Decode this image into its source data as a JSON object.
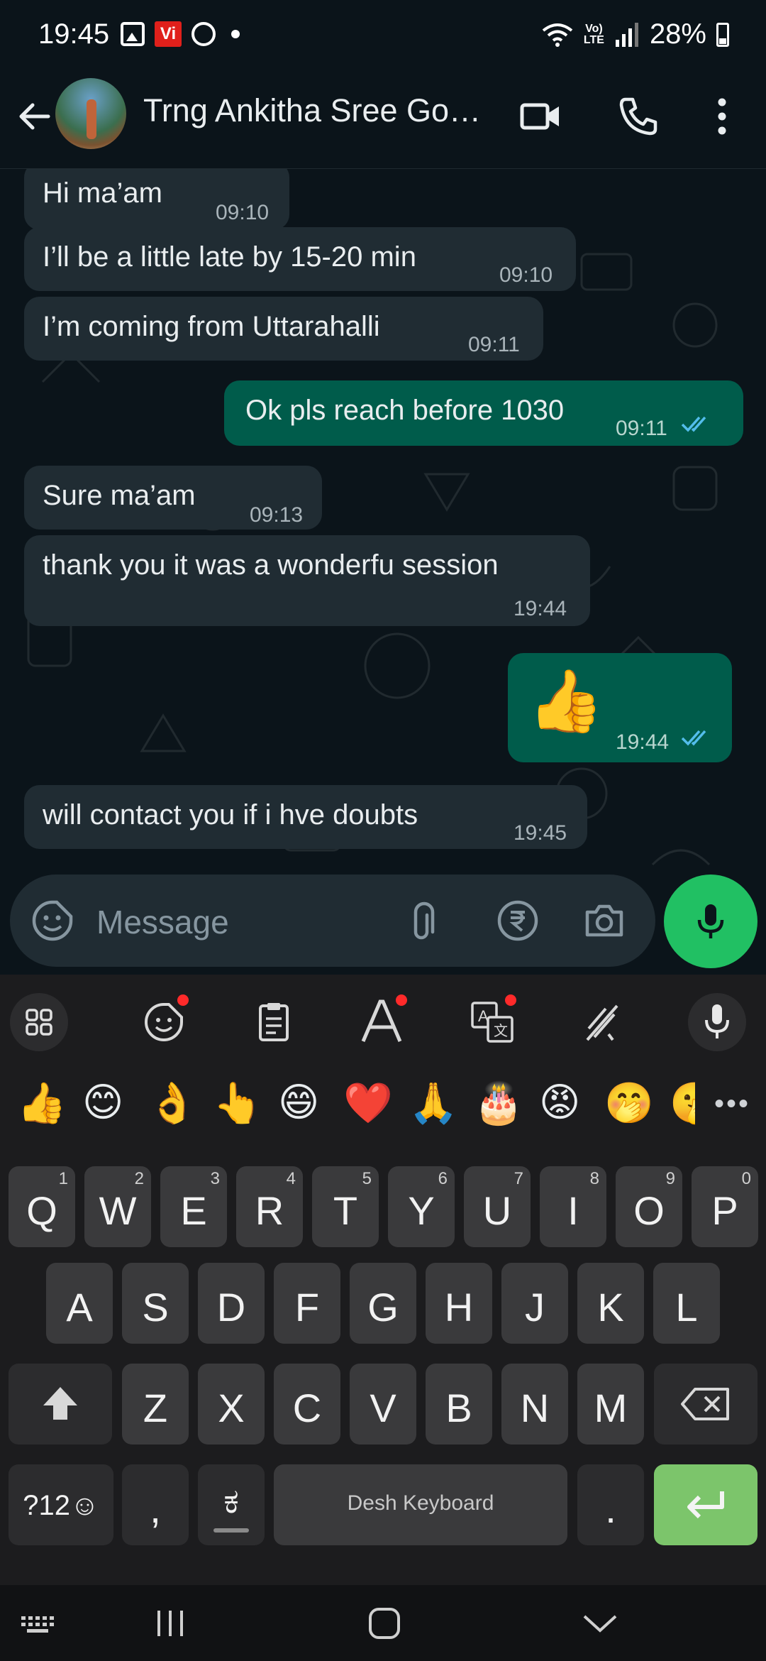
{
  "status_bar": {
    "time": "19:45",
    "volte": "Vo)\nLTE",
    "battery": "28%",
    "vi_label": "Vi"
  },
  "header": {
    "title": "Trng Ankitha Sree Go…",
    "icons": [
      "back-arrow-icon",
      "video-call-icon",
      "phone-icon",
      "more-vert-icon"
    ]
  },
  "messages": [
    {
      "dir": "in",
      "text": "Hi ma’am",
      "time": "09:10"
    },
    {
      "dir": "in",
      "text": "I’ll be a little late by 15-20 min",
      "time": "09:10"
    },
    {
      "dir": "in",
      "text": "I’m coming from Uttarahalli",
      "time": "09:11"
    },
    {
      "dir": "out",
      "text": "Ok pls reach before 1030",
      "time": "09:11",
      "status": "read"
    },
    {
      "dir": "in",
      "text": "Sure ma’am",
      "time": "09:13"
    },
    {
      "dir": "in",
      "text": "thank you it was a wonderfu session",
      "time": "19:44"
    },
    {
      "dir": "out",
      "text": "👍",
      "time": "19:44",
      "status": "read"
    },
    {
      "dir": "in",
      "text": "will contact you if i hve doubts",
      "time": "19:45"
    }
  ],
  "input": {
    "placeholder": "Message",
    "icons": [
      "sticker-icon",
      "attach-icon",
      "rupee-payment-icon",
      "camera-icon",
      "mic-icon"
    ]
  },
  "keyboard": {
    "toolbar_icons": [
      "apps-grid-icon",
      "sticker-emoji-icon",
      "clipboard-icon",
      "text-style-icon",
      "translate-icon",
      "handwriting-icon",
      "voice-input-icon"
    ],
    "emojis": [
      "👍",
      "😊",
      "👌",
      "👆",
      "😄",
      "❤️",
      "🙏",
      "🎂",
      "😡",
      "🤭",
      "🤫"
    ],
    "more": "•••",
    "row1": [
      "Q",
      "W",
      "E",
      "R",
      "T",
      "Y",
      "U",
      "I",
      "O",
      "P"
    ],
    "row1_numbers": [
      "1",
      "2",
      "3",
      "4",
      "5",
      "6",
      "7",
      "8",
      "9",
      "0"
    ],
    "row2": [
      "A",
      "S",
      "D",
      "F",
      "G",
      "H",
      "J",
      "K",
      "L"
    ],
    "row3": [
      "Z",
      "X",
      "C",
      "V",
      "B",
      "N",
      "M"
    ],
    "symbols_key": "?12☺",
    "comma_key": ",",
    "lang_key": "ಕ",
    "space_label": "Desh Keyboard",
    "period_key": ".",
    "enter_key": "↵"
  },
  "colors": {
    "bg": "#0b141a",
    "incoming": "#202c33",
    "outgoing": "#005c4b",
    "read_ticks": "#53bdeb",
    "mic_fab": "#21c063",
    "enter_key": "#7cc56b"
  },
  "nav_bar": {
    "icons": [
      "keyboard-hide-icon",
      "recents-icon",
      "home-icon",
      "back-down-icon"
    ]
  }
}
